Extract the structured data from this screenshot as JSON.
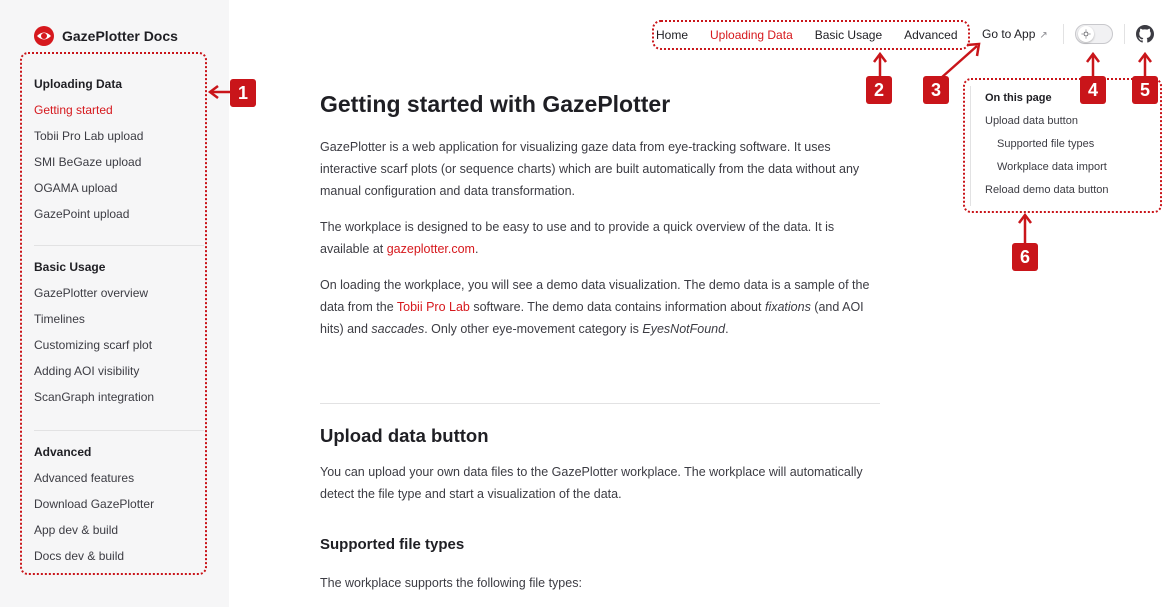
{
  "brand": {
    "title": "GazePlotter Docs",
    "accent": "#d6181d"
  },
  "sidebar": {
    "groups": [
      {
        "title": "Uploading Data",
        "items": [
          "Getting started",
          "Tobii Pro Lab upload",
          "SMI BeGaze upload",
          "OGAMA upload",
          "GazePoint upload"
        ]
      },
      {
        "title": "Basic Usage",
        "items": [
          "GazePlotter overview",
          "Timelines",
          "Customizing scarf plot",
          "Adding AOI visibility",
          "ScanGraph integration"
        ]
      },
      {
        "title": "Advanced",
        "items": [
          "Advanced features",
          "Download GazePlotter",
          "App dev & build",
          "Docs dev & build"
        ]
      }
    ],
    "active_item": "Getting started"
  },
  "nav": {
    "items": [
      "Home",
      "Uploading Data",
      "Basic Usage",
      "Advanced"
    ],
    "active": "Uploading Data",
    "goto_label": "Go to App",
    "goto_icon": "external-link-icon",
    "theme_icon": "sun-icon",
    "repo_icon": "github-icon"
  },
  "annotations": [
    "1",
    "2",
    "3",
    "4",
    "5",
    "6"
  ],
  "content": {
    "title": "Getting started with GazePlotter",
    "p1": "GazePlotter is a web application for visualizing gaze data from eye-tracking software. It uses interactive scarf plots (or sequence charts) which are built automatically from the data without any manual configuration and data transformation.",
    "p2_text": "The workplace is designed to be easy to use and to provide a quick overview of the data. It is available at ",
    "p2_link": "gazeplotter.com",
    "p2_end": ".",
    "p3_a": "On loading the workplace, you will see a demo data visualization. The demo data is a sample of the data from the ",
    "p3_link": "Tobii Pro Lab",
    "p3_b": " software. The demo data contains information about ",
    "p3_em1": "fixations",
    "p3_c": " (and AOI hits) and ",
    "p3_em2": "saccades",
    "p3_d": ". Only other eye-movement category is ",
    "p3_em3": "EyesNotFound",
    "p3_e": ".",
    "h2": "Upload data button",
    "p4": "You can upload your own data files to the GazePlotter workplace. The workplace will automatically detect the file type and start a visualization of the data.",
    "h3": "Supported file types",
    "p5": "The workplace supports the following file types:"
  },
  "outline": {
    "title": "On this page",
    "items": [
      {
        "label": "Upload data button",
        "level": 1
      },
      {
        "label": "Supported file types",
        "level": 2
      },
      {
        "label": "Workplace data import",
        "level": 2
      },
      {
        "label": "Reload demo data button",
        "level": 1
      }
    ]
  }
}
